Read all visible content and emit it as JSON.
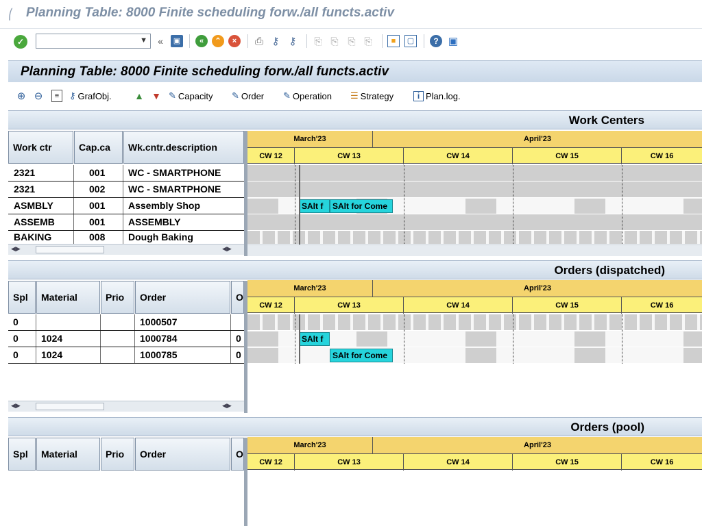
{
  "window": {
    "title": "Planning Table: 8000 Finite scheduling forw./all functs.activ"
  },
  "standard_toolbar": {
    "command_field_value": "",
    "icons": [
      "check-icon",
      "save-icon",
      "back-icon",
      "exit-icon",
      "cancel-icon",
      "print-icon",
      "find-icon",
      "find-next-icon",
      "first-page-icon",
      "previous-page-icon",
      "next-page-icon",
      "last-page-icon",
      "create-session-icon",
      "shortcut-icon",
      "help-icon",
      "customize-layout-icon"
    ]
  },
  "app_title": "Planning Table: 8000 Finite scheduling forw./all functs.activ",
  "app_toolbar": {
    "grafobj": "GrafObj.",
    "capacity": "Capacity",
    "order": "Order",
    "operation": "Operation",
    "strategy": "Strategy",
    "planlog": "Plan.log."
  },
  "timescale": {
    "months": [
      "March'23",
      "April'23"
    ],
    "weeks": [
      "CW 12",
      "CW 13",
      "CW 14",
      "CW 15",
      "CW 16"
    ]
  },
  "work_centers": {
    "title": "Work Centers",
    "columns": [
      "Work ctr",
      "Cap.ca",
      "Wk.cntr.description"
    ],
    "rows": [
      {
        "work_ctr": "2321",
        "cap": "001",
        "desc": "WC - SMARTPHONE"
      },
      {
        "work_ctr": "2321",
        "cap": "002",
        "desc": "WC - SMARTPHONE"
      },
      {
        "work_ctr": "ASMBLY",
        "cap": "001",
        "desc": "Assembly Shop"
      },
      {
        "work_ctr": "ASSEMB",
        "cap": "001",
        "desc": "ASSEMBLY"
      },
      {
        "work_ctr": "BAKING",
        "cap": "008",
        "desc": "Dough Baking"
      }
    ],
    "tasks": [
      {
        "label": "SAlt f"
      },
      {
        "label": "SAlt for Come"
      }
    ]
  },
  "orders_dispatched": {
    "title": "Orders (dispatched)",
    "columns": [
      "Spl",
      "Material",
      "Prio",
      "Order",
      "O"
    ],
    "rows": [
      {
        "spl": "0",
        "material": "",
        "prio": "",
        "order": "1000507",
        "o": ""
      },
      {
        "spl": "0",
        "material": "1024",
        "prio": "",
        "order": "1000784",
        "o": "0"
      },
      {
        "spl": "0",
        "material": "1024",
        "prio": "",
        "order": "1000785",
        "o": "0"
      }
    ],
    "tasks": [
      {
        "label": "SAlt f"
      },
      {
        "label": "SAlt for Come"
      }
    ]
  },
  "orders_pool": {
    "title": "Orders (pool)",
    "columns": [
      "Spl",
      "Material",
      "Prio",
      "Order",
      "O"
    ]
  },
  "colors": {
    "task": "#26d4dc",
    "month_header": "#f4d46e",
    "week_header": "#fbf07a",
    "nonwork": "#cfcfcf",
    "header_blue": "#cfdbe8"
  }
}
